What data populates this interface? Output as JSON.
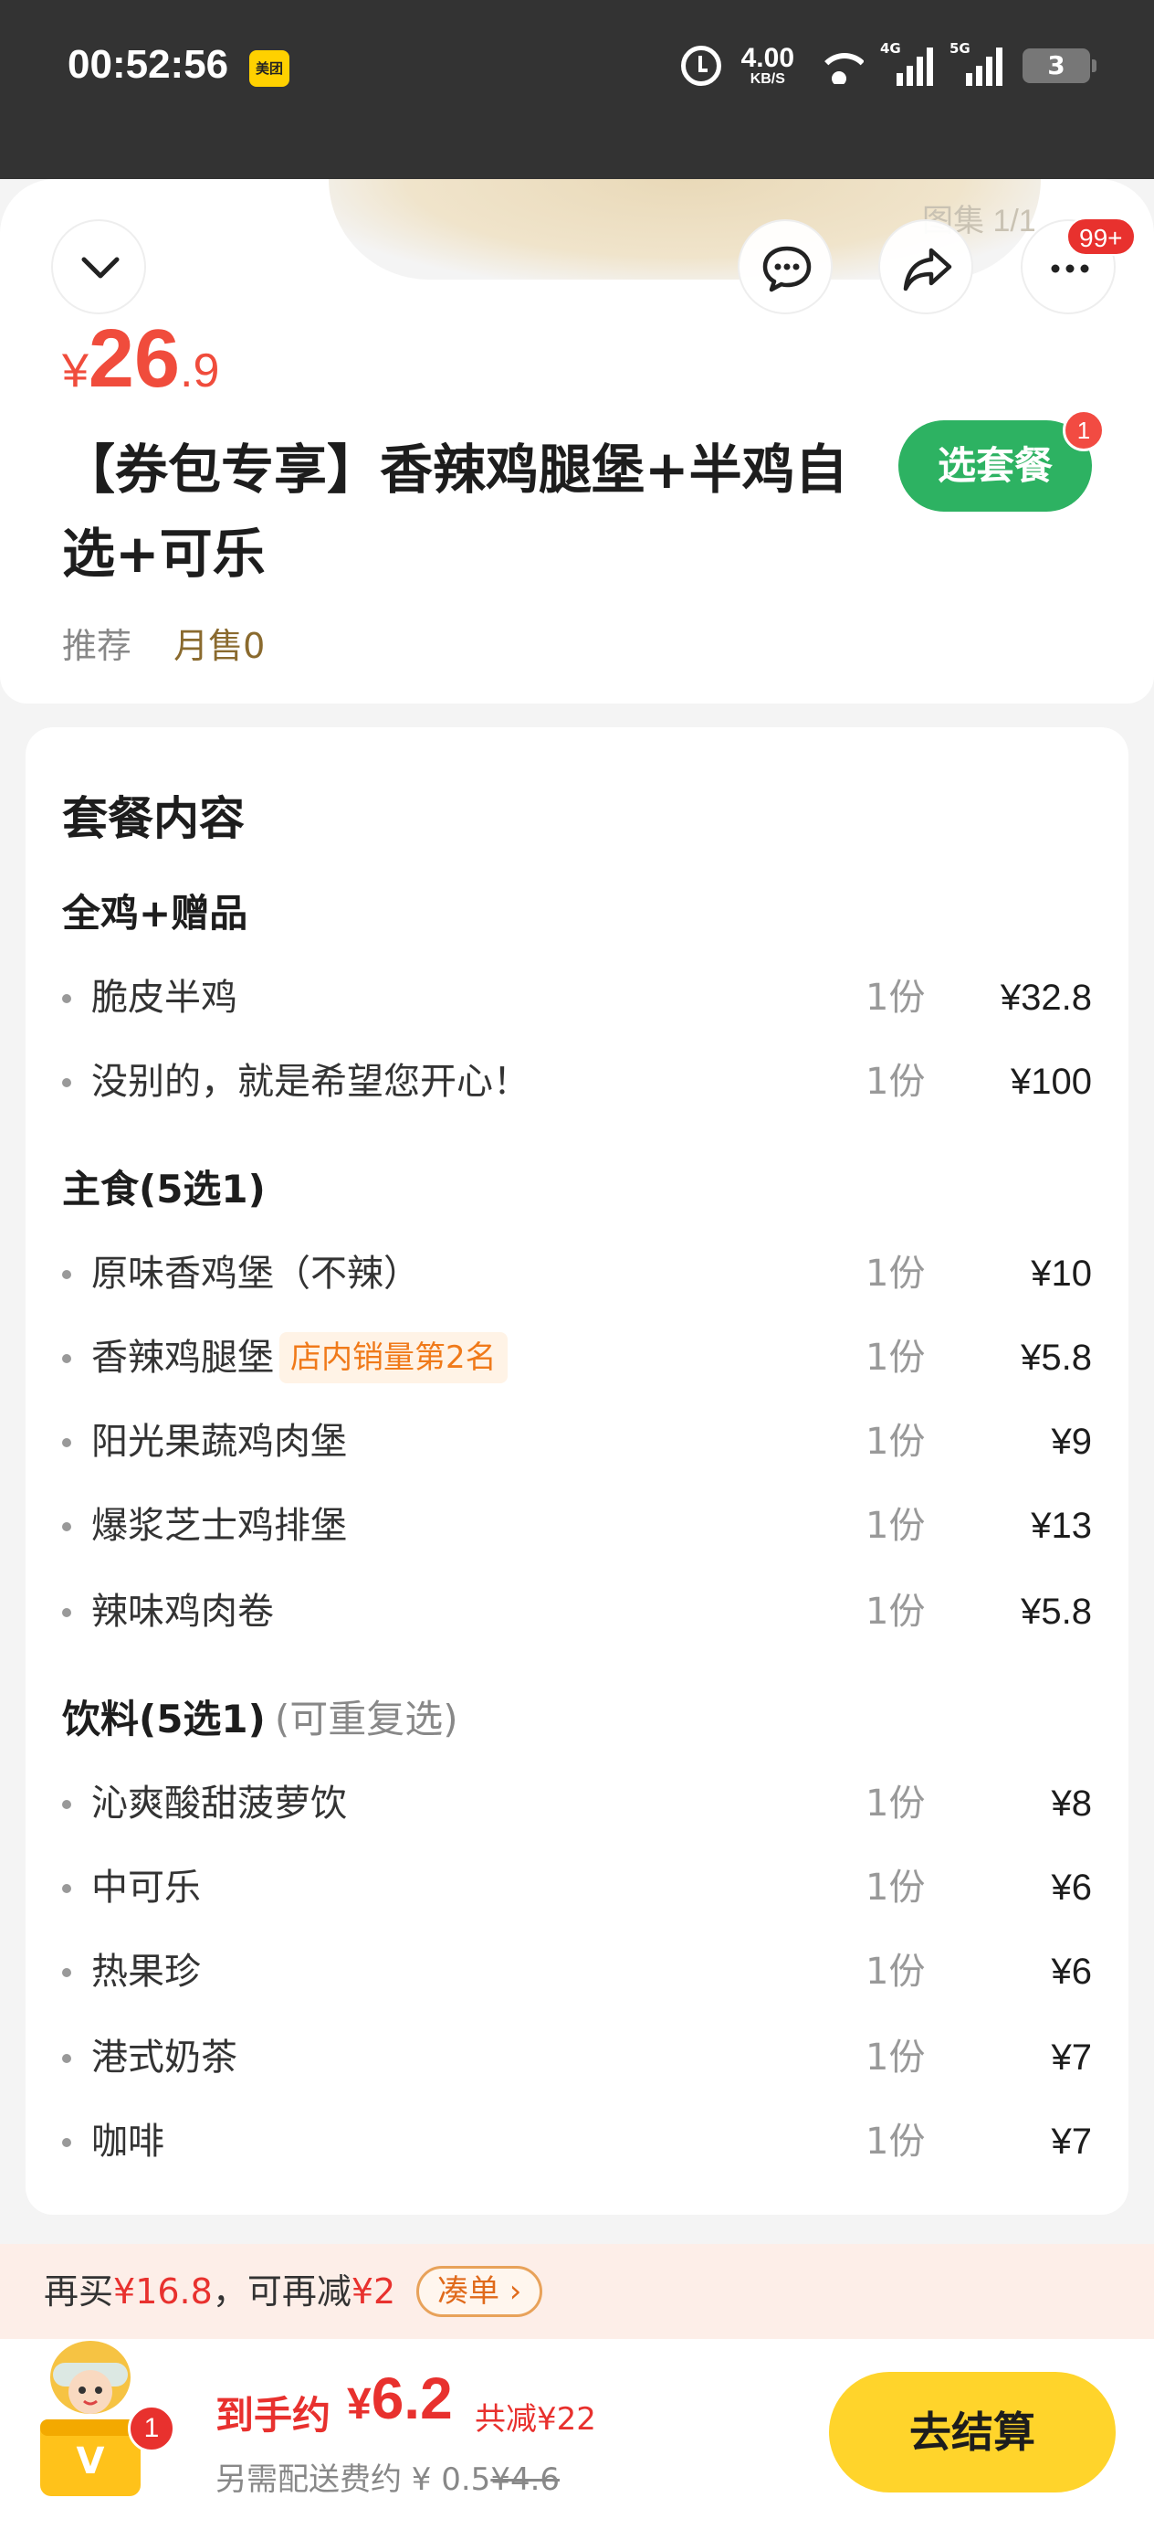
{
  "status_bar": {
    "time": "00:52:56",
    "app_badge": "美团",
    "net_speed_value": "4.00",
    "net_speed_unit": "KB/S",
    "signal1_label": "4G",
    "signal2_label": "5G",
    "battery": "3"
  },
  "header": {
    "gallery_label": "图集 1/1",
    "more_badge": "99+"
  },
  "product": {
    "price_currency": "¥",
    "price_integer": "26",
    "price_decimal": ".9",
    "title": "【券包专享】香辣鸡腿堡+半鸡自选+可乐",
    "choose_button": "选套餐",
    "choose_badge": "1",
    "tag": "推荐",
    "monthly_sales": "月售0"
  },
  "set_contents": {
    "title": "套餐内容",
    "groups": [
      {
        "title": "全鸡+赠品",
        "note": "",
        "items": [
          {
            "name": "脆皮半鸡",
            "hot": "",
            "qty": "1份",
            "price": "¥32.8"
          },
          {
            "name": "没别的，就是希望您开心！",
            "hot": "",
            "qty": "1份",
            "price": "¥100"
          }
        ]
      },
      {
        "title": "主食(5选1)",
        "note": "",
        "items": [
          {
            "name": "原味香鸡堡（不辣）",
            "hot": "",
            "qty": "1份",
            "price": "¥10"
          },
          {
            "name": "香辣鸡腿堡",
            "hot": "店内销量第2名",
            "qty": "1份",
            "price": "¥5.8"
          },
          {
            "name": "阳光果蔬鸡肉堡",
            "hot": "",
            "qty": "1份",
            "price": "¥9"
          },
          {
            "name": "爆浆芝士鸡排堡",
            "hot": "",
            "qty": "1份",
            "price": "¥13"
          },
          {
            "name": "辣味鸡肉卷",
            "hot": "",
            "qty": "1份",
            "price": "¥5.8"
          }
        ]
      },
      {
        "title": "饮料(5选1)",
        "note": "(可重复选)",
        "items": [
          {
            "name": "沁爽酸甜菠萝饮",
            "hot": "",
            "qty": "1份",
            "price": "¥8"
          },
          {
            "name": "中可乐",
            "hot": "",
            "qty": "1份",
            "price": "¥6"
          },
          {
            "name": "热果珍",
            "hot": "",
            "qty": "1份",
            "price": "¥6"
          },
          {
            "name": "港式奶茶",
            "hot": "",
            "qty": "1份",
            "price": "¥7"
          },
          {
            "name": "咖啡",
            "hot": "",
            "qty": "1份",
            "price": "¥7"
          }
        ]
      }
    ]
  },
  "promo": {
    "prefix": "再买",
    "amount": "¥16.8",
    "middle": "，可再减",
    "discount": "¥2",
    "link": "凑单 ›"
  },
  "bottom_bar": {
    "cart_badge": "1",
    "final_label": "到手约",
    "final_currency": "¥",
    "final_price": "6.2",
    "saving": "共减¥22",
    "delivery_prefix": "另需配送费约 ¥ 0.5",
    "delivery_old": "¥4.6",
    "checkout": "去结算"
  },
  "colors": {
    "accent_red": "#f04c3c",
    "green": "#2db262",
    "yellow": "#ffd42b",
    "status_bar": "#333333"
  }
}
